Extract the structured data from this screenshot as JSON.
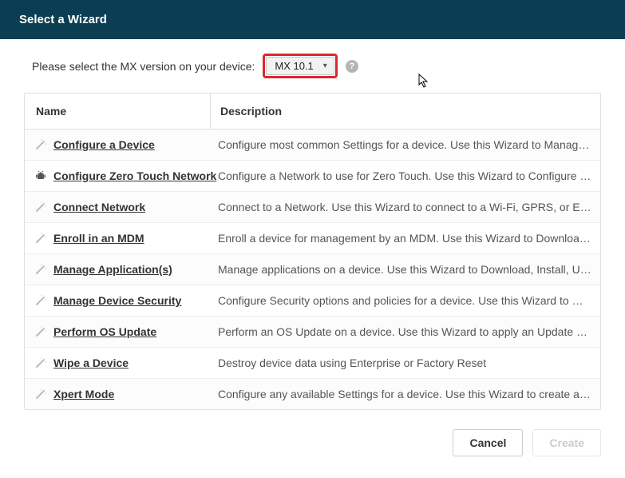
{
  "header": {
    "title": "Select a Wizard"
  },
  "prompt": {
    "text": "Please select the MX version on your device:"
  },
  "mx_select": {
    "value": "MX 10.1"
  },
  "table": {
    "columns": {
      "name": "Name",
      "description": "Description"
    },
    "rows": [
      {
        "icon": "wand",
        "name": "Configure a Device",
        "description": "Configure most common Settings for a device. Use this Wizard to Manage…"
      },
      {
        "icon": "android",
        "name": "Configure Zero Touch Network",
        "description": "Configure a Network to use for Zero Touch. Use this Wizard to Configure a…"
      },
      {
        "icon": "wand",
        "name": "Connect Network",
        "description": "Connect to a Network. Use this Wizard to connect to a Wi-Fi, GPRS, or Ether…"
      },
      {
        "icon": "wand",
        "name": "Enroll in an MDM",
        "description": "Enroll a device for management by an MDM.  Use this Wizard to Download,…"
      },
      {
        "icon": "wand",
        "name": "Manage Application(s)",
        "description": "Manage applications on a device.  Use this Wizard to Download, Install, Uni…"
      },
      {
        "icon": "wand",
        "name": "Manage Device Security",
        "description": "Configure Security options and policies for a device.  Use this Wizard to Wh…"
      },
      {
        "icon": "wand",
        "name": "Perform OS Update",
        "description": "Perform an OS Update on a device.  Use this Wizard to apply an Update or a…"
      },
      {
        "icon": "wand",
        "name": "Wipe a Device",
        "description": "Destroy device data using Enterprise or Factory Reset"
      },
      {
        "icon": "wand",
        "name": "Xpert Mode",
        "description": "Configure any available Settings for a device. Use this Wizard to create any…"
      }
    ]
  },
  "footer": {
    "cancel": "Cancel",
    "create": "Create"
  }
}
